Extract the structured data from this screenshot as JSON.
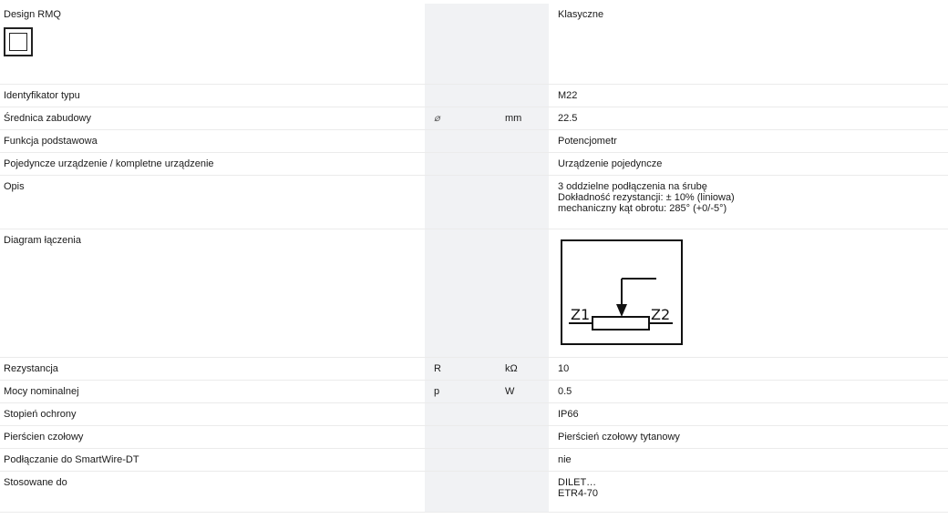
{
  "rows": [
    {
      "name": "Design RMQ",
      "symbol": "",
      "unit": "",
      "value": "Klasyczne"
    },
    {
      "name": "Identyfikator typu",
      "symbol": "",
      "unit": "",
      "value": "M22"
    },
    {
      "name": "Średnica zabudowy",
      "symbol": "⌀",
      "unit": "mm",
      "value": "22.5"
    },
    {
      "name": "Funkcja podstawowa",
      "symbol": "",
      "unit": "",
      "value": "Potencjometr"
    },
    {
      "name": "Pojedyncze urządzenie / kompletne urządzenie",
      "symbol": "",
      "unit": "",
      "value": "Urządzenie pojedyncze"
    },
    {
      "name": "Opis",
      "symbol": "",
      "unit": "",
      "value_lines": [
        "3 oddzielne podłączenia na śrubę",
        "Dokładność rezystancji: ± 10% (liniowa)",
        "mechaniczny kąt obrotu: 285° (+0/-5°)"
      ]
    },
    {
      "name": "Diagram łączenia",
      "symbol": "",
      "unit": "",
      "diagram_labels": [
        "Z1",
        "Z2"
      ]
    },
    {
      "name": "Rezystancja",
      "symbol": "R",
      "unit": "kΩ",
      "value": "10"
    },
    {
      "name": "Mocy nominalnej",
      "symbol": "p",
      "unit": "W",
      "value": "0.5"
    },
    {
      "name": "Stopień ochrony",
      "symbol": "",
      "unit": "",
      "value": "IP66"
    },
    {
      "name": "Pierścien czołowy",
      "symbol": "",
      "unit": "",
      "value": "Pierścień czołowy tytanowy"
    },
    {
      "name": "Podłączanie do SmartWire-DT",
      "symbol": "",
      "unit": "",
      "value": "nie"
    },
    {
      "name": "Stosowane do",
      "symbol": "",
      "unit": "",
      "value_lines": [
        "DILET…",
        "ETR4-70"
      ]
    }
  ]
}
